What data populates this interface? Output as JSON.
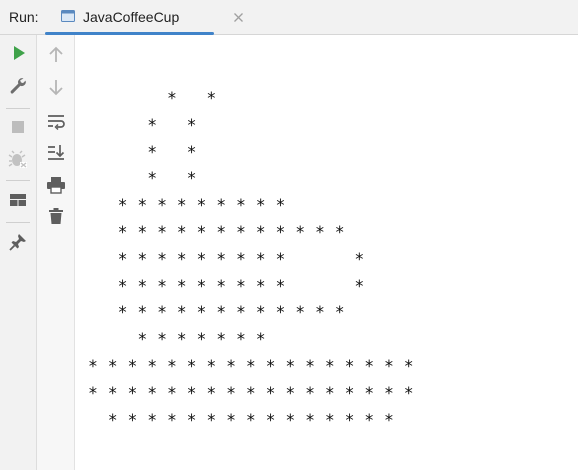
{
  "run_panel": {
    "label": "Run:",
    "tab": {
      "title": "JavaCoffeeCup",
      "icon": "console-window-icon",
      "close_icon": "close-icon"
    }
  },
  "left_toolbar": [
    {
      "icon": "run-icon",
      "color": "#3fa24a"
    },
    {
      "icon": "wrench-icon"
    },
    {
      "icon": "stop-icon"
    },
    {
      "icon": "debug-bug-icon"
    },
    {
      "icon": "layout-icon"
    },
    {
      "icon": "pin-icon"
    }
  ],
  "second_toolbar": [
    {
      "icon": "up-arrow-icon"
    },
    {
      "icon": "down-arrow-icon"
    },
    {
      "icon": "soft-wrap-icon"
    },
    {
      "icon": "scroll-to-end-icon"
    },
    {
      "icon": "print-icon"
    },
    {
      "icon": "trash-icon"
    }
  ],
  "console": {
    "lines": [
      "        *   *",
      "      *   *",
      "      *   *",
      "      *   *",
      "   * * * * * * * * *",
      "   * * * * * * * * * * * *",
      "   * * * * * * * * *       *",
      "   * * * * * * * * *       *",
      "   * * * * * * * * * * * *",
      "     * * * * * * *",
      "* * * * * * * * * * * * * * * * *",
      "* * * * * * * * * * * * * * * * *",
      "  * * * * * * * * * * * * * * *"
    ]
  },
  "colors": {
    "accent": "#4083c9",
    "run_green": "#3fa24a",
    "icon_gray": "#6e6e6e"
  }
}
